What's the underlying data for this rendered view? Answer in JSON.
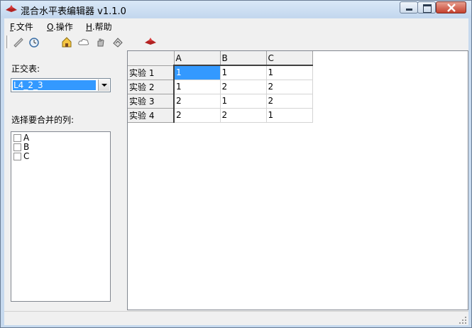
{
  "window": {
    "title": "混合水平表编辑器 v1.1.0"
  },
  "menu": [
    {
      "key": "F",
      "label": ".文件"
    },
    {
      "key": "O",
      "label": ".操作"
    },
    {
      "key": "H",
      "label": ".帮助"
    }
  ],
  "toolbar": {
    "icons": [
      "pen-icon",
      "clock-icon",
      "house-icon",
      "cloud-icon",
      "hand-icon",
      "paint-icon",
      "app-logo-icon"
    ]
  },
  "left": {
    "orthogonal_label": "正交表:",
    "orthogonal_value": "L4_2_3",
    "merge_label": "选择要合并的列:",
    "columns": [
      "A",
      "B",
      "C"
    ]
  },
  "grid": {
    "columns": [
      "A",
      "B",
      "C"
    ],
    "rows": [
      {
        "label": "实验 1",
        "values": [
          "1",
          "1",
          "1"
        ]
      },
      {
        "label": "实验 2",
        "values": [
          "1",
          "2",
          "2"
        ]
      },
      {
        "label": "实验 3",
        "values": [
          "2",
          "1",
          "2"
        ]
      },
      {
        "label": "实验 4",
        "values": [
          "2",
          "2",
          "1"
        ]
      }
    ]
  },
  "colors": {
    "selection": "#3399ff",
    "titlebar": "#c6d9ee",
    "close_button": "#c5412e"
  }
}
